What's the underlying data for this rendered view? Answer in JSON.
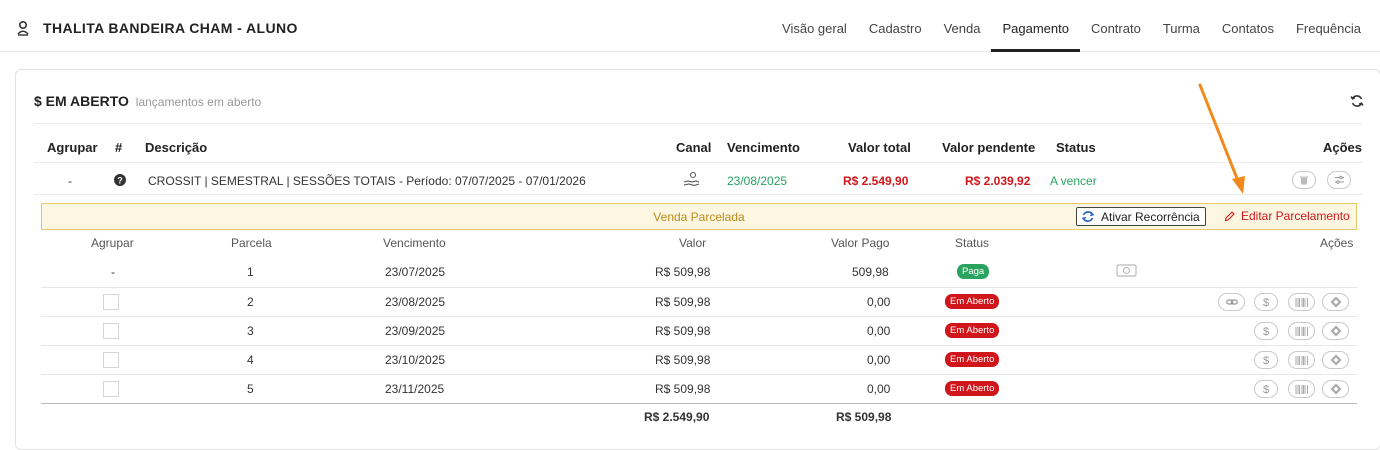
{
  "header": {
    "student_name": "THALITA BANDEIRA CHAM - ALUNO",
    "tabs": [
      "Visão geral",
      "Cadastro",
      "Venda",
      "Pagamento",
      "Contrato",
      "Turma",
      "Contatos",
      "Frequência"
    ],
    "active_tab": "Pagamento"
  },
  "card": {
    "title": "$ EM ABERTO",
    "subtitle": "lançamentos em aberto"
  },
  "main_table": {
    "headers": {
      "agrupar": "Agrupar",
      "num": "#",
      "descricao": "Descrição",
      "canal": "Canal",
      "vencimento": "Vencimento",
      "valor_total": "Valor total",
      "valor_pendente": "Valor pendente",
      "status": "Status",
      "acoes": "Ações"
    },
    "row": {
      "agrupar": "-",
      "descricao": "CROSSIT | SEMESTRAL | SESSÕES TOTAIS - Período: 07/07/2025 - 07/01/2026",
      "vencimento": "23/08/2025",
      "valor_total": "R$ 2.549,90",
      "valor_pendente": "R$ 2.039,92",
      "status": "A vencer"
    }
  },
  "parcelamento": {
    "label": "Venda Parcelada",
    "ativar_recorrencia": "Ativar Recorrência",
    "editar_parcelamento": "Editar Parcelamento",
    "headers": {
      "agrupar": "Agrupar",
      "parcela": "Parcela",
      "vencimento": "Vencimento",
      "valor": "Valor",
      "valor_pago": "Valor Pago",
      "status": "Status",
      "acoes": "Ações"
    },
    "rows": [
      {
        "agrupar": "-",
        "parcela": "1",
        "vencimento": "23/07/2025",
        "valor": "R$ 509,98",
        "valor_pago": "509,98",
        "status": "Paga"
      },
      {
        "agrupar": "",
        "parcela": "2",
        "vencimento": "23/08/2025",
        "valor": "R$ 509,98",
        "valor_pago": "0,00",
        "status": "Em Aberto"
      },
      {
        "agrupar": "",
        "parcela": "3",
        "vencimento": "23/09/2025",
        "valor": "R$ 509,98",
        "valor_pago": "0,00",
        "status": "Em Aberto"
      },
      {
        "agrupar": "",
        "parcela": "4",
        "vencimento": "23/10/2025",
        "valor": "R$ 509,98",
        "valor_pago": "0,00",
        "status": "Em Aberto"
      },
      {
        "agrupar": "",
        "parcela": "5",
        "vencimento": "23/11/2025",
        "valor": "R$ 509,98",
        "valor_pago": "0,00",
        "status": "Em Aberto"
      }
    ],
    "totals": {
      "valor": "R$ 2.549,90",
      "valor_pago": "R$ 509,98"
    }
  },
  "colors": {
    "green": "#27a164",
    "red": "#d0161b",
    "bar_bg": "#fdf7e2",
    "bar_text": "#b98a1b",
    "annotation_arrow": "#f28a1b"
  },
  "icons": [
    "user-icon",
    "refresh-icon",
    "help-icon",
    "hand-coin-icon",
    "trash-icon",
    "sliders-icon",
    "recurrence-icon",
    "pencil-icon",
    "cash-icon",
    "link-icon",
    "dollar-icon",
    "barcode-icon",
    "pix-icon"
  ]
}
